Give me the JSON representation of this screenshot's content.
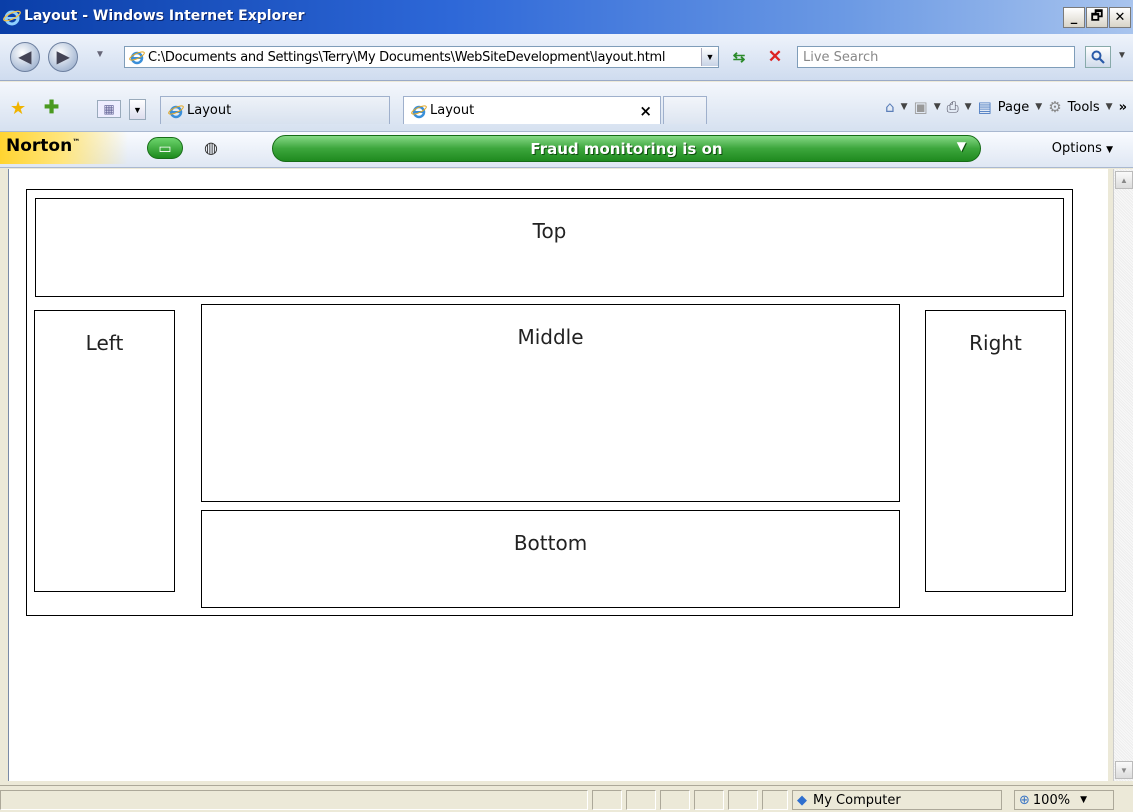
{
  "window": {
    "title": "Layout - Windows Internet Explorer",
    "minimize": "_",
    "maximize": "🗗",
    "close": "✕"
  },
  "navbar": {
    "back": "◀",
    "forward": "▶",
    "address": "C:\\Documents and Settings\\Terry\\My Documents\\WebSiteDevelopment\\layout.html",
    "search_placeholder": "Live Search"
  },
  "tabs": [
    {
      "label": "Layout",
      "active": false
    },
    {
      "label": "Layout",
      "active": true
    }
  ],
  "tab_close": "×",
  "command_bar": {
    "page": "Page",
    "tools": "Tools",
    "more": "»"
  },
  "norton": {
    "logo": "Norton",
    "tm": "™",
    "status": "Fraud monitoring is on",
    "options": "Options"
  },
  "page": {
    "top": "Top",
    "left": "Left",
    "middle": "Middle",
    "bottom": "Bottom",
    "right": "Right"
  },
  "statusbar": {
    "zone": "My Computer",
    "zoom": "100%"
  },
  "icons": {
    "ie": "ie-logo-icon",
    "favorites": "star-icon",
    "add_favorites": "add-favorite-icon",
    "home": "home-icon",
    "feeds": "rss-icon",
    "print": "print-icon",
    "page": "page-icon",
    "tools": "gear-icon"
  }
}
